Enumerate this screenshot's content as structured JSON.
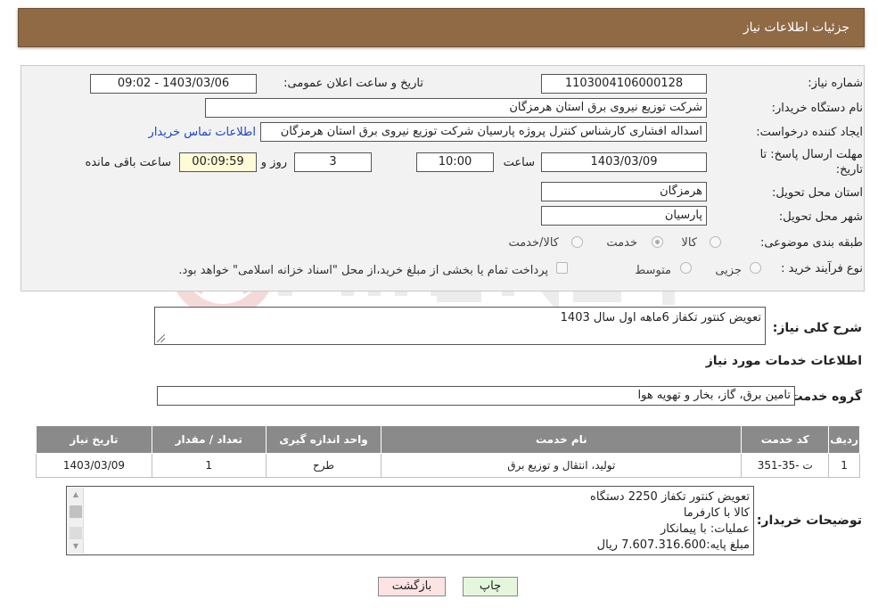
{
  "header": {
    "title": "جزئیات اطلاعات نیاز"
  },
  "form": {
    "need_number_label": "شماره نیاز:",
    "need_number": "1103004106000128",
    "announce_label": "تاریخ و ساعت اعلان عمومی:",
    "announce_value": "1403/03/06 - 09:02",
    "buyer_label": "نام دستگاه خریدار:",
    "buyer_value": "شرکت توزیع نیروی برق استان هرمزگان",
    "creator_label": "ایجاد کننده درخواست:",
    "creator_value": "اسداله افشاری کارشناس کنترل پروژه پارسیان شرکت توزیع نیروی برق استان هرمزگان",
    "contact_link": "اطلاعات تماس خریدار",
    "deadline_label_line1": "مهلت ارسال پاسخ: تا",
    "deadline_label_line2": "تاریخ:",
    "deadline_date": "1403/03/09",
    "time_label": "ساعت",
    "deadline_time": "10:00",
    "days_value": "3",
    "days_label": "روز و",
    "remaining_time": "00:09:59",
    "remaining_label": "ساعت باقی مانده",
    "province_label": "استان محل تحویل:",
    "province_value": "هرمزگان",
    "city_label": "شهر محل تحویل:",
    "city_value": "پارسیان",
    "category_label": "طبقه بندی موضوعی:",
    "category_options": [
      "کالا",
      "خدمت",
      "کالا/خدمت"
    ],
    "category_selected": "خدمت",
    "process_label": "نوع فرآیند خرید :",
    "process_options": [
      "جزیی",
      "متوسط"
    ],
    "payment_note": "پرداخت تمام یا بخشی از مبلغ خرید،از محل \"اسناد خزانه اسلامی\" خواهد بود."
  },
  "summary": {
    "label": "شرح کلی نیاز:",
    "value": "تعویض کنتور تکفاز 6ماهه اول سال 1403"
  },
  "services": {
    "section_title": "اطلاعات خدمات مورد نیاز",
    "group_label": "گروه خدمت:",
    "group_value": "تامین برق، گاز، بخار و تهویه هوا",
    "columns": [
      "ردیف",
      "کد خدمت",
      "نام خدمت",
      "واحد اندازه گیری",
      "تعداد / مقدار",
      "تاریخ نیاز"
    ],
    "rows": [
      [
        "1",
        "ت -35-351",
        "تولید، انتقال و توزیع برق",
        "طرح",
        "1",
        "1403/03/09"
      ]
    ]
  },
  "buyer_notes": {
    "label": "توضیحات خریدار:",
    "lines": [
      "تعویض کنتور تکفاز 2250 دستگاه",
      "کالا با کارفرما",
      "عملیات: با پیمانکار",
      "مبلغ پایه:7.607.316.600 ریال"
    ]
  },
  "buttons": {
    "print": "چاپ",
    "back": "بازگشت"
  },
  "colors": {
    "header": "#8f6a45",
    "table_header": "#8a8a8a",
    "link": "#1a44c4",
    "back_button": "#fde3e3",
    "print_button": "#e4f7dd"
  }
}
